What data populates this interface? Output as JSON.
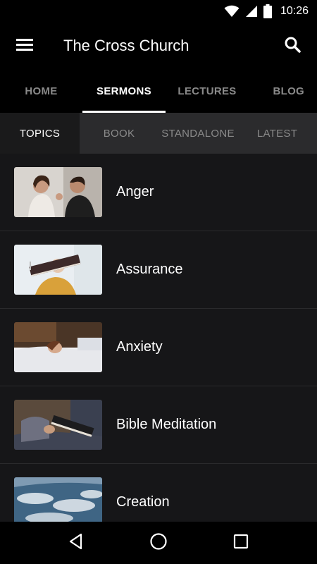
{
  "status_bar": {
    "time": "10:26",
    "icons": [
      "wifi-icon",
      "cell-signal-icon",
      "battery-icon"
    ]
  },
  "app_bar": {
    "title": "The Cross Church",
    "menu_icon": "hamburger-menu-icon",
    "search_icon": "search-icon"
  },
  "main_tabs": [
    {
      "label": "HOME",
      "active": false
    },
    {
      "label": "SERMONS",
      "active": true
    },
    {
      "label": "LECTURES",
      "active": false
    },
    {
      "label": "BLOG",
      "active": false
    }
  ],
  "sub_tabs": [
    {
      "label": "TOPICS",
      "active": true
    },
    {
      "label": "BOOK",
      "active": false
    },
    {
      "label": "STANDALONE",
      "active": false
    },
    {
      "label": "LATEST",
      "active": false
    }
  ],
  "topics": [
    {
      "label": "Anger",
      "thumbnail": "two-people-arguing-image"
    },
    {
      "label": "Assurance",
      "thumbnail": "person-holding-bible-image"
    },
    {
      "label": "Anxiety",
      "thumbnail": "person-lying-in-bed-image"
    },
    {
      "label": "Bible Meditation",
      "thumbnail": "person-reading-bible-image"
    },
    {
      "label": "Creation",
      "thumbnail": "earth-from-space-image"
    }
  ],
  "nav_bar": {
    "icons": [
      "back-icon",
      "home-icon",
      "recents-icon"
    ]
  },
  "colors": {
    "background": "#000000",
    "list_background": "#161618",
    "sub_tab_bar": "#2b2b2d",
    "active_text": "#ffffff",
    "inactive_text": "#8a8a8a"
  }
}
